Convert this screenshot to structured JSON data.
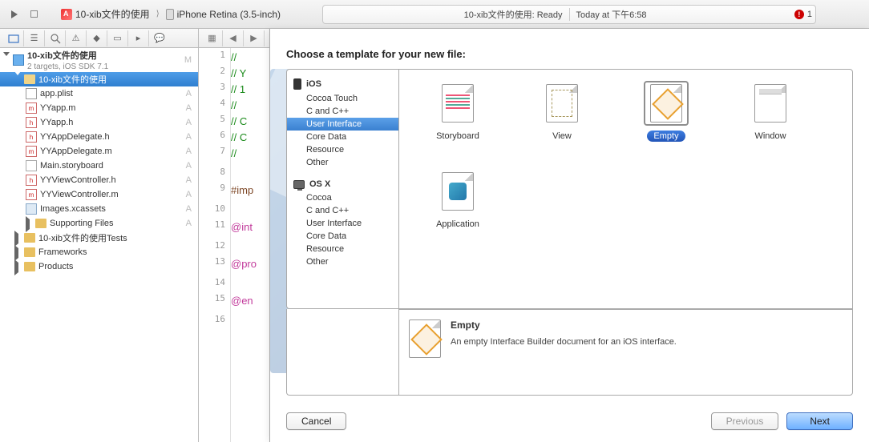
{
  "toolbar": {
    "breadcrumb_project": "10-xib文件的使用",
    "breadcrumb_device": "iPhone Retina (3.5-inch)",
    "status_left": "10-xib文件的使用: Ready",
    "status_right": "Today at 下午6:58",
    "error_count": "1"
  },
  "sidebar": {
    "project": {
      "name": "10-xib文件的使用",
      "subtitle": "2 targets, iOS SDK 7.1",
      "status": "M"
    },
    "group1": {
      "name": "10-xib文件的使用"
    },
    "files": [
      {
        "name": "app.plist",
        "status": "A",
        "type": "plist"
      },
      {
        "name": "YYapp.m",
        "status": "A",
        "type": "m"
      },
      {
        "name": "YYapp.h",
        "status": "A",
        "type": "h"
      },
      {
        "name": "YYAppDelegate.h",
        "status": "A",
        "type": "h"
      },
      {
        "name": "YYAppDelegate.m",
        "status": "A",
        "type": "m"
      },
      {
        "name": "Main.storyboard",
        "status": "A",
        "type": "sb"
      },
      {
        "name": "YYViewController.h",
        "status": "A",
        "type": "h"
      },
      {
        "name": "YYViewController.m",
        "status": "A",
        "type": "m"
      },
      {
        "name": "Images.xcassets",
        "status": "A",
        "type": "assets"
      }
    ],
    "subgroups": [
      "Supporting Files",
      "10-xib文件的使用Tests",
      "Frameworks",
      "Products"
    ]
  },
  "editor": {
    "lines": [
      {
        "n": "1",
        "cls": "c-comment",
        "t": "//"
      },
      {
        "n": "2",
        "cls": "c-comment",
        "t": "//  Y"
      },
      {
        "n": "3",
        "cls": "c-comment",
        "t": "//  1"
      },
      {
        "n": "4",
        "cls": "c-comment",
        "t": "//"
      },
      {
        "n": "5",
        "cls": "c-comment",
        "t": "//  C"
      },
      {
        "n": "6",
        "cls": "c-comment",
        "t": "//  C"
      },
      {
        "n": "7",
        "cls": "c-comment",
        "t": "//"
      },
      {
        "n": "8",
        "cls": "",
        "t": ""
      },
      {
        "n": "9",
        "cls": "c-pp",
        "t": "#imp"
      },
      {
        "n": "10",
        "cls": "",
        "t": ""
      },
      {
        "n": "11",
        "cls": "c-kw",
        "t": "@int"
      },
      {
        "n": "12",
        "cls": "",
        "t": ""
      },
      {
        "n": "13",
        "cls": "c-kw",
        "t": "@pro"
      },
      {
        "n": "14",
        "cls": "",
        "t": ""
      },
      {
        "n": "15",
        "cls": "c-kw",
        "t": "@en"
      },
      {
        "n": "16",
        "cls": "",
        "t": ""
      }
    ]
  },
  "sheet": {
    "title": "Choose a template for your new file:",
    "ios_label": "iOS",
    "osx_label": "OS X",
    "ios_cats": [
      "Cocoa Touch",
      "C and C++",
      "User Interface",
      "Core Data",
      "Resource",
      "Other"
    ],
    "osx_cats": [
      "Cocoa",
      "C and C++",
      "User Interface",
      "Core Data",
      "Resource",
      "Other"
    ],
    "selected_cat_index": 2,
    "templates": [
      {
        "label": "Storyboard",
        "type": "sb"
      },
      {
        "label": "View",
        "type": "view"
      },
      {
        "label": "Empty",
        "type": "empty-ic",
        "selected": true
      },
      {
        "label": "Window",
        "type": "window"
      },
      {
        "label": "Application",
        "type": "app"
      }
    ],
    "desc_title": "Empty",
    "desc_body": "An empty Interface Builder document for an iOS interface.",
    "cancel": "Cancel",
    "previous": "Previous",
    "next": "Next"
  }
}
